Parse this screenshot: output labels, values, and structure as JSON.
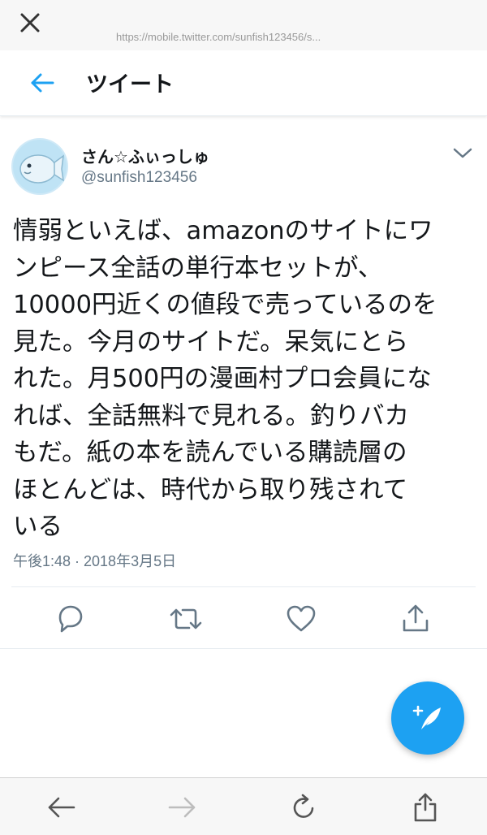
{
  "browser": {
    "url": "https://mobile.twitter.com/sunfish123456/s..."
  },
  "header": {
    "title": "ツイート"
  },
  "tweet": {
    "display_name": "さん☆ふぃっしゅ",
    "handle": "@sunfish123456",
    "text": "情弱といえば、amazonのサイトにワ\nンピース全話の単行本セットが、\n10000円近くの値段で売っているのを\n見た。今月のサイトだ。呆気にとら\nれた。月500円の漫画村プロ会員にな\nれば、全話無料で見れる。釣りバカ\nもだ。紙の本を読んでいる購読層の\nほとんどは、時代から取り残されて\nいる",
    "timestamp": "午後1:48 · 2018年3月5日"
  },
  "actions": {
    "icons": [
      "reply-icon",
      "retweet-icon",
      "like-icon",
      "share-icon"
    ]
  },
  "fab": {
    "icon": "compose-icon"
  },
  "bottom_bar": {
    "icons": [
      "back-icon",
      "forward-icon",
      "reload-icon",
      "share-icon"
    ]
  },
  "colors": {
    "accent": "#1da1f2",
    "secondary_text": "#657786",
    "primary_text": "#14171a"
  }
}
